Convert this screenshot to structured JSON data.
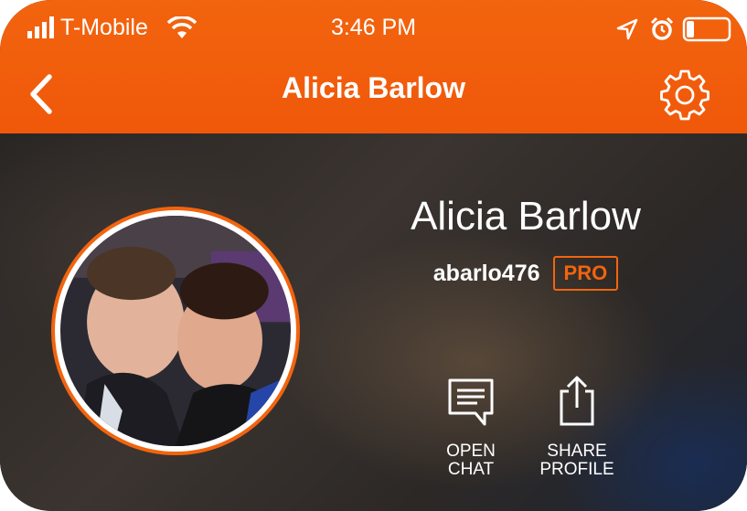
{
  "status_bar": {
    "carrier": "T-Mobile",
    "time": "3:46 PM",
    "icons": [
      "signal-icon",
      "wifi-icon",
      "location-icon",
      "alarm-icon",
      "battery-icon"
    ]
  },
  "nav": {
    "title": "Alicia Barlow",
    "back_icon": "chevron-left-icon",
    "settings_icon": "gear-icon"
  },
  "profile": {
    "name": "Alicia Barlow",
    "username": "abarlo476",
    "badge": "PRO",
    "avatar": "profile-photo"
  },
  "actions": [
    {
      "label": "OPEN\nCHAT",
      "icon": "chat-icon"
    },
    {
      "label": "SHARE\nPROFILE",
      "icon": "share-icon"
    }
  ],
  "colors": {
    "accent": "#f2640e",
    "text": "#ffffff"
  }
}
